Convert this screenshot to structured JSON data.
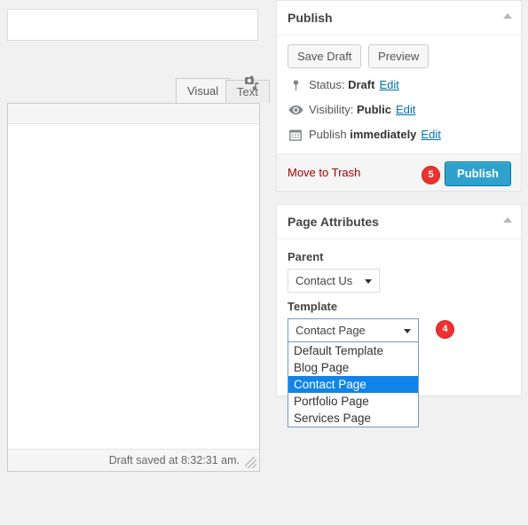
{
  "editor": {
    "title_value": "",
    "title_placeholder": "",
    "tabs": [
      {
        "label": "Visual",
        "active": true
      },
      {
        "label": "Text",
        "active": false
      }
    ],
    "add_media_icon": "add-media-icon",
    "content_value": "",
    "status_text": "Draft saved at 8:32:31 am."
  },
  "publish_panel": {
    "title": "Publish",
    "toggle_icon": "triangle-up-icon",
    "save_draft_label": "Save Draft",
    "preview_label": "Preview",
    "rows": [
      {
        "icon": "pin-icon",
        "prefix": "Status:",
        "value": "Draft",
        "edit_label": "Edit"
      },
      {
        "icon": "eye-icon",
        "prefix": "Visibility:",
        "value": "Public",
        "edit_label": "Edit"
      },
      {
        "icon": "calendar-icon",
        "prefix": "Publish",
        "value": "immediately",
        "edit_label": "Edit"
      }
    ],
    "trash_label": "Move to Trash",
    "publish_label": "Publish",
    "badge": "5",
    "badge_color": "#ee3131",
    "publish_color": "#2ea2cc",
    "trash_color": "#a00"
  },
  "page_attributes": {
    "title": "Page Attributes",
    "toggle_icon": "triangle-up-icon",
    "parent_label": "Parent",
    "parent_value": "Contact Us",
    "template_label": "Template",
    "template_value": "Contact Page",
    "template_badge": "4",
    "template_options": [
      {
        "label": "Default Template",
        "selected": false
      },
      {
        "label": "Blog Page",
        "selected": false
      },
      {
        "label": "Contact Page",
        "selected": true
      },
      {
        "label": "Portfolio Page",
        "selected": false
      },
      {
        "label": "Services Page",
        "selected": false
      }
    ],
    "highlight_color": "#1283e8"
  }
}
